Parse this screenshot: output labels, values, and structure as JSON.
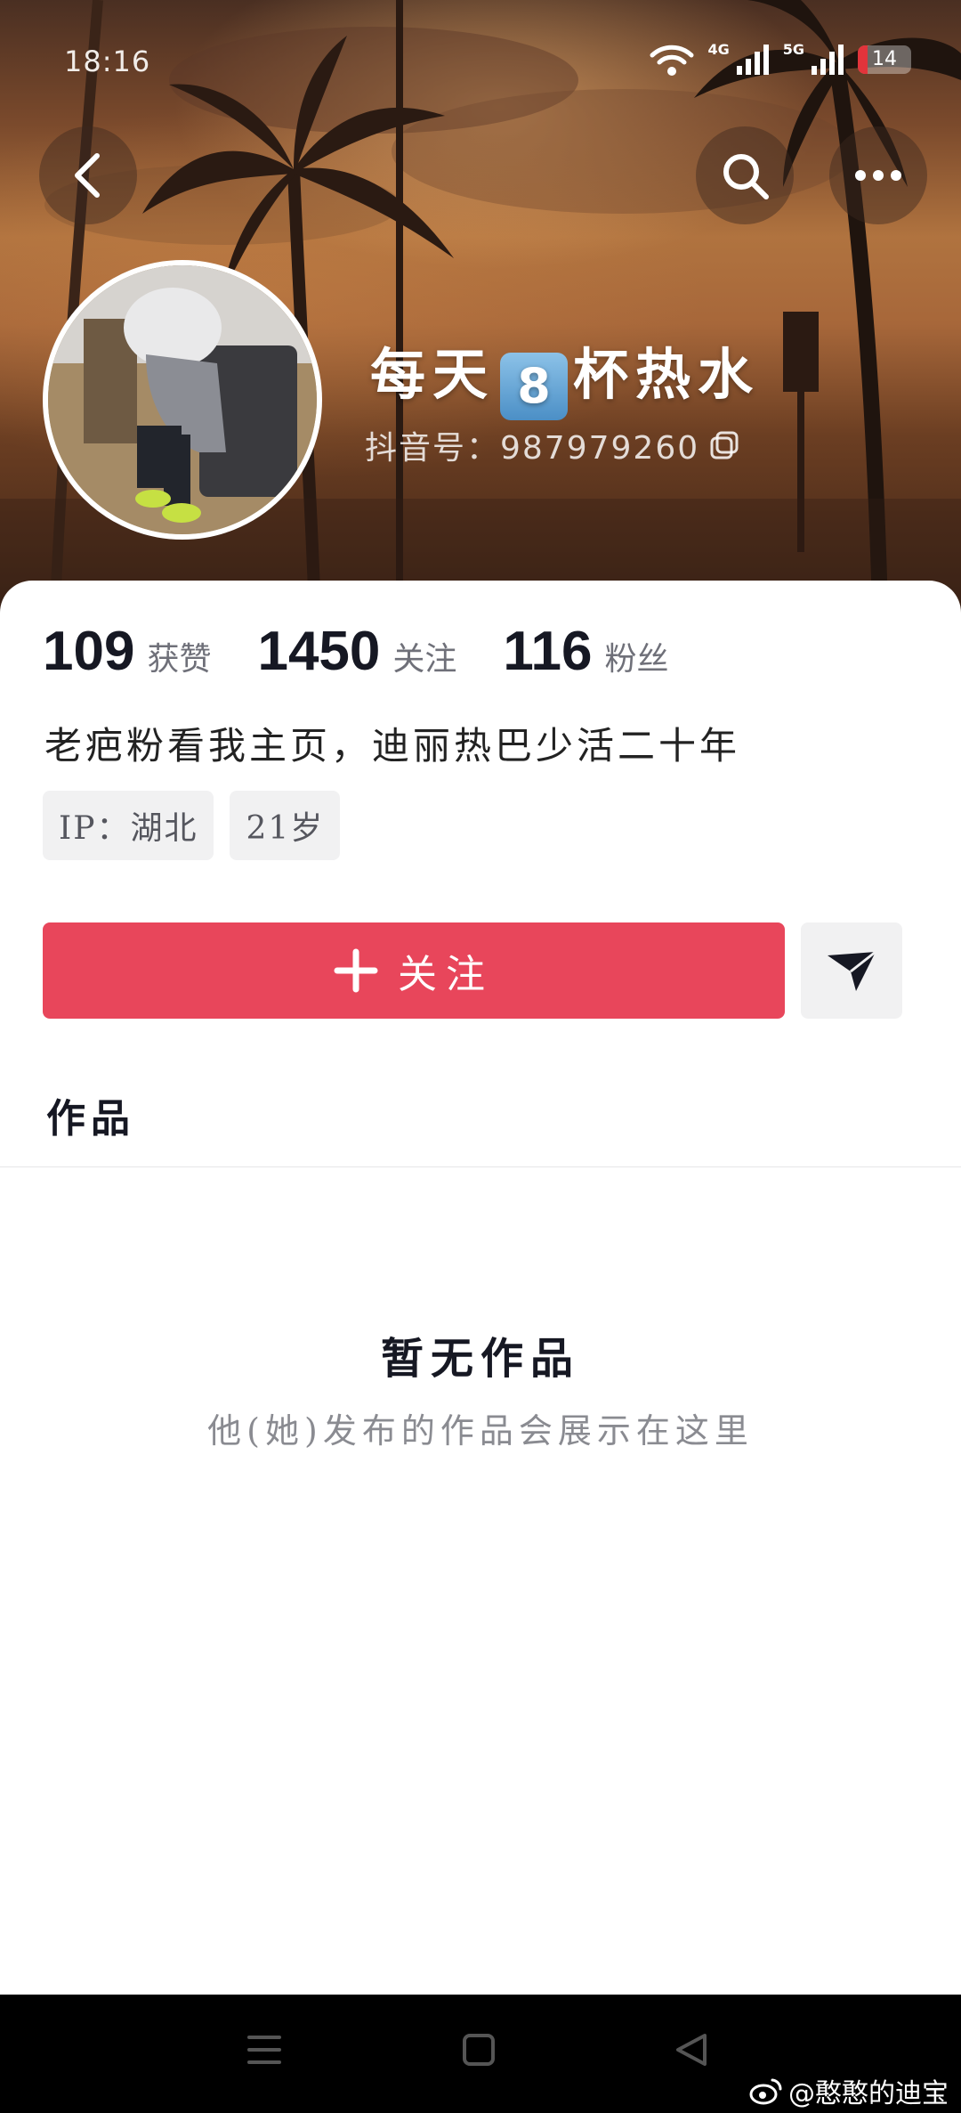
{
  "status_bar": {
    "time": "18:16",
    "network_1": "4G",
    "network_2": "5G",
    "battery": "14",
    "battery_level_percent": 14
  },
  "profile": {
    "nickname_pre": "每天",
    "nickname_emoji_digit": "8",
    "nickname_post": "杯热水",
    "douyin_id": "抖音号：987979260",
    "stats": [
      {
        "value": "109",
        "label": "获赞"
      },
      {
        "value": "1450",
        "label": "关注"
      },
      {
        "value": "116",
        "label": "粉丝"
      }
    ],
    "bio": "老疤粉看我主页，迪丽热巴少活二十年",
    "tags": [
      "IP：湖北",
      "21岁"
    ]
  },
  "actions": {
    "follow_label": "关注"
  },
  "tabs": {
    "works": "作品"
  },
  "empty_state": {
    "title": "暂无作品",
    "subtitle": "他(她)发布的作品会展示在这里"
  },
  "watermark": "@憨憨的迪宝",
  "colors": {
    "accent": "#e8465b",
    "text_primary": "#161823",
    "text_secondary": "#8a8b91"
  },
  "icons": [
    "back-icon",
    "search-icon",
    "more-icon",
    "copy-icon",
    "plus-icon",
    "send-icon",
    "menu-icon",
    "home-icon",
    "back-triangle-icon",
    "weibo-icon"
  ]
}
